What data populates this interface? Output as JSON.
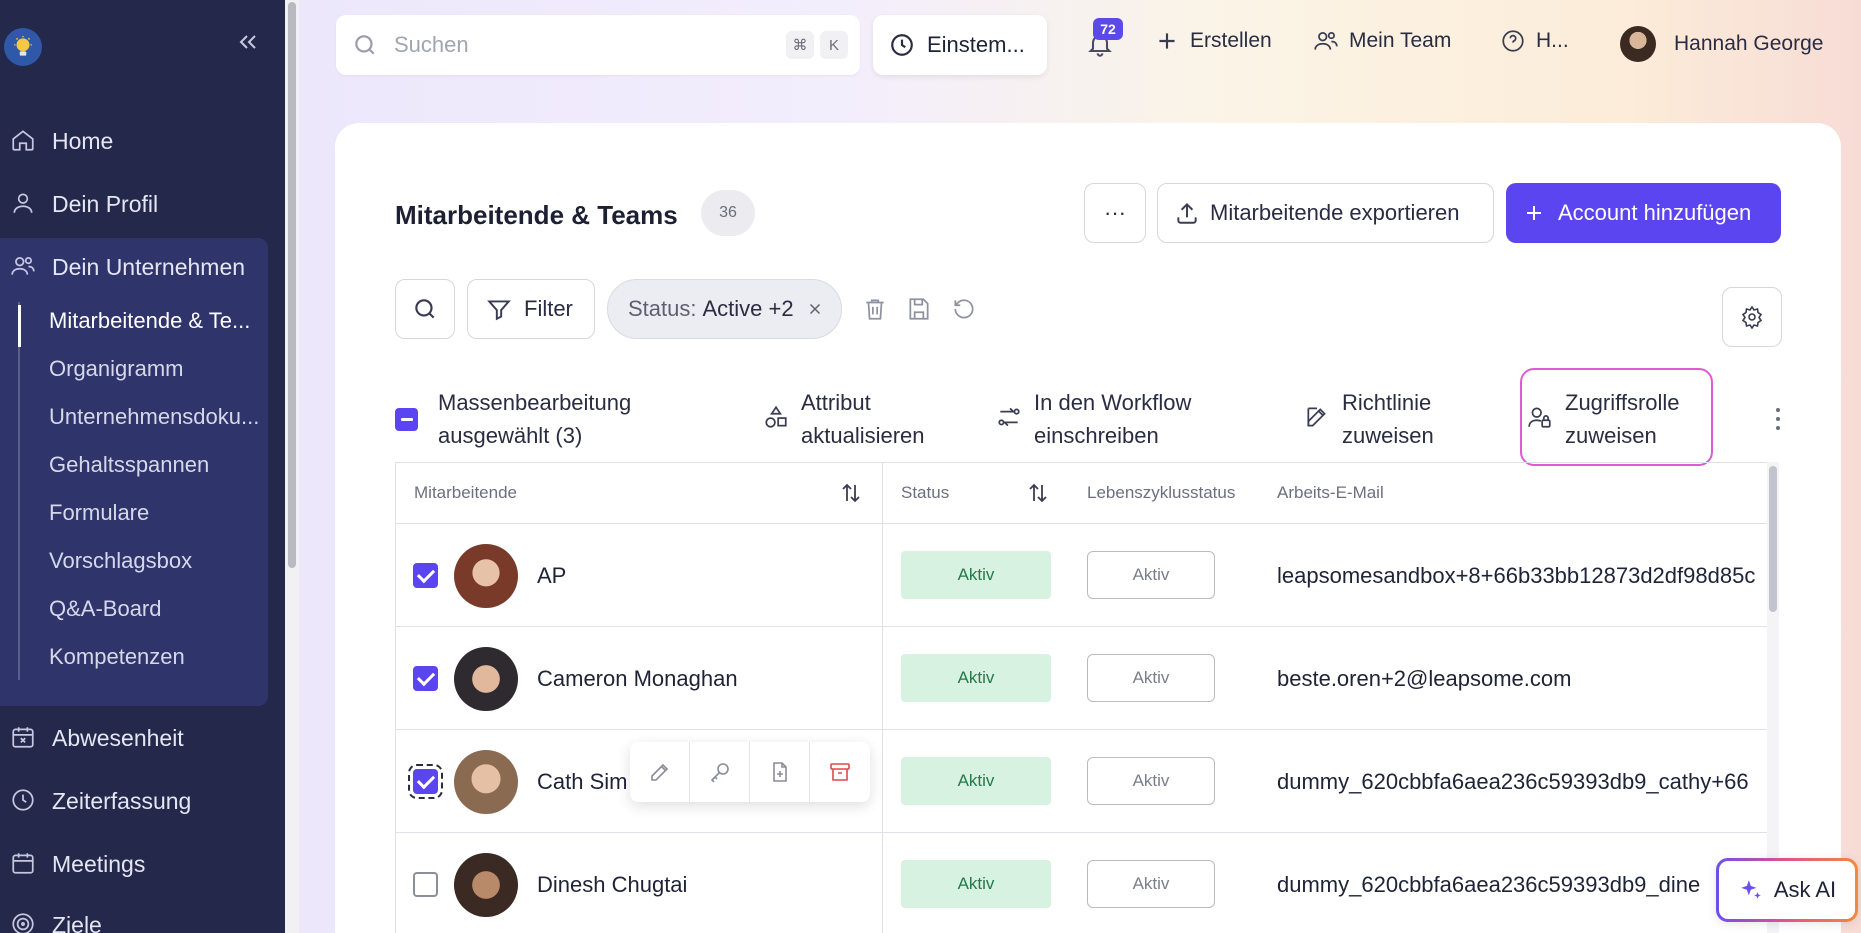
{
  "sidebar": {
    "nav": [
      {
        "label": "Home",
        "icon": "home-icon"
      },
      {
        "label": "Dein Profil",
        "icon": "user-icon"
      },
      {
        "label": "Dein Unternehmen",
        "icon": "users-icon"
      },
      {
        "label": "Abwesenheit",
        "icon": "calendar-x-icon"
      },
      {
        "label": "Zeiterfassung",
        "icon": "clock-icon"
      },
      {
        "label": "Meetings",
        "icon": "calendar-icon"
      },
      {
        "label": "Ziele",
        "icon": "target-icon"
      }
    ],
    "company_items": [
      {
        "label": "Mitarbeitende & Te...",
        "active": true
      },
      {
        "label": "Organigramm"
      },
      {
        "label": "Unternehmensdoku..."
      },
      {
        "label": "Gehaltsspannen"
      },
      {
        "label": "Formulare"
      },
      {
        "label": "Vorschlagsbox"
      },
      {
        "label": "Q&A-Board"
      },
      {
        "label": "Kompetenzen"
      }
    ]
  },
  "topbar": {
    "search_placeholder": "Suchen",
    "kbd_cmd": "⌘",
    "kbd_k": "K",
    "settings_label": "Einstem...",
    "notification_count": "72",
    "create_label": "Erstellen",
    "team_label": "Mein Team",
    "help_label": "H...",
    "user_name": "Hannah George"
  },
  "page": {
    "title": "Mitarbeitende & Teams",
    "count": "36",
    "more_label": "···",
    "export_label": "Mitarbeitende exportieren",
    "add_label": "Account hinzufügen",
    "filter_label": "Filter",
    "status_filter_key": "Status:",
    "status_filter_value": "Active +2"
  },
  "bulk": {
    "line1": "Massenbearbeitung",
    "line2": "ausgewählt (3)",
    "actions": [
      {
        "line1": "Attribut",
        "line2": "aktualisieren"
      },
      {
        "line1": "In den Workflow",
        "line2": "einschreiben"
      },
      {
        "line1": "Richtlinie",
        "line2": "zuweisen"
      },
      {
        "line1": "Zugriffsrolle",
        "line2": "zuweisen"
      }
    ]
  },
  "table": {
    "headers": {
      "employee": "Mitarbeitende",
      "status": "Status",
      "lifecycle": "Lebenszyklusstatus",
      "email": "Arbeits-E-Mail"
    },
    "rows": [
      {
        "name": "AP",
        "status": "Aktiv",
        "lifecycle": "Aktiv",
        "email": "leapsomesandbox+8+66b33bb12873d2df98d85c",
        "checked": true
      },
      {
        "name": "Cameron Monaghan",
        "status": "Aktiv",
        "lifecycle": "Aktiv",
        "email": "beste.oren+2@leapsome.com",
        "checked": true
      },
      {
        "name": "Cath Sim",
        "status": "Aktiv",
        "lifecycle": "Aktiv",
        "email": "dummy_620cbbfa6aea236c59393db9_cathy+66",
        "checked": true
      },
      {
        "name": "Dinesh Chugtai",
        "status": "Aktiv",
        "lifecycle": "Aktiv",
        "email": "dummy_620cbbfa6aea236c59393db9_dine",
        "checked": false
      }
    ]
  },
  "ask_ai_label": "Ask AI",
  "colors": {
    "sidebar": "#24284a",
    "accent": "#5b45f0",
    "status_bg": "#d8f2e2",
    "status_text": "#237a4b",
    "highlight": "#e05ad6"
  }
}
